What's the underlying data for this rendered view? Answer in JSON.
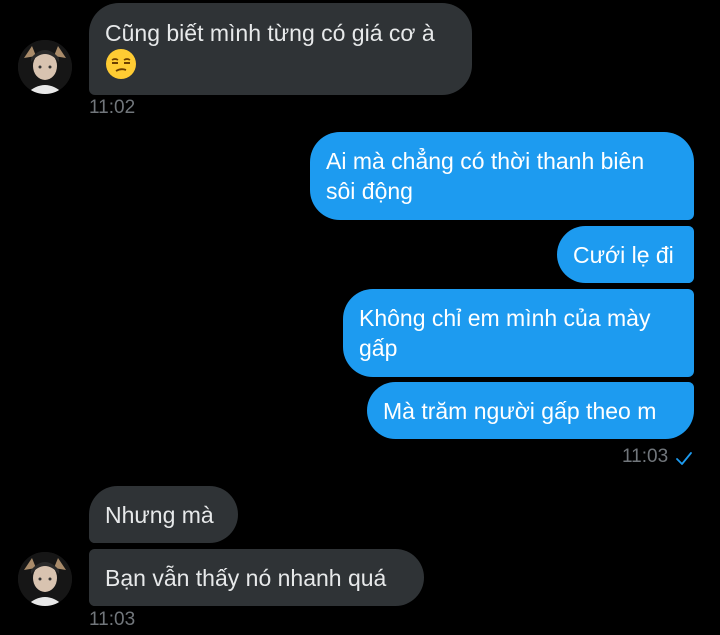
{
  "colors": {
    "background": "#000000",
    "incoming_bubble": "#2f3336",
    "outgoing_bubble": "#1d9bf0",
    "timestamp": "#71767b",
    "read_check": "#1d9bf0"
  },
  "messages": [
    {
      "sender": "other",
      "text": "Cũng biết mình từng có giá cơ à",
      "emoji": "unamused-face-icon"
    },
    {
      "sender": "self",
      "line1": "Ai mà chẳng có thời thanh biên",
      "line2": "sôi động"
    },
    {
      "sender": "self",
      "text": "Cưới lẹ đi"
    },
    {
      "sender": "self",
      "line1": "Không chỉ em mình của mày",
      "line2": "gấp"
    },
    {
      "sender": "self",
      "text": "Mà trăm người gấp theo m"
    },
    {
      "sender": "other",
      "text": "Nhưng mà"
    },
    {
      "sender": "other",
      "text": "Bạn vẫn thấy nó nhanh quá"
    }
  ],
  "timestamps": {
    "first": "11:02",
    "second": "11:03",
    "third": "11:03"
  }
}
